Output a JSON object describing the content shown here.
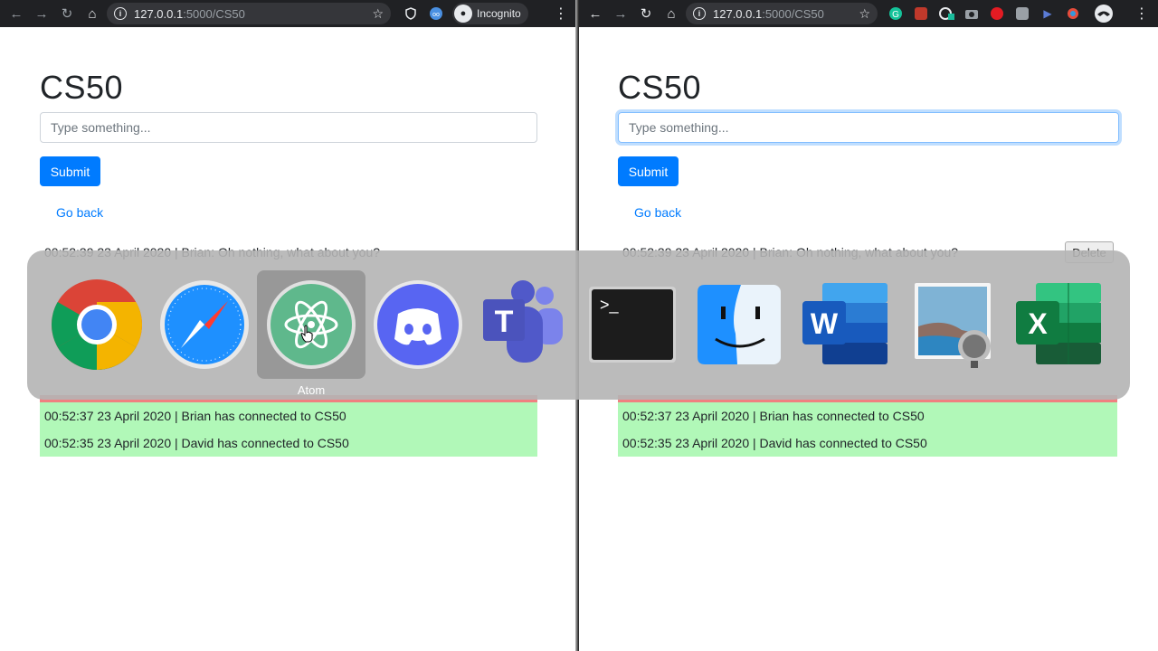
{
  "left_browser": {
    "url_host": "127.0.0.1",
    "url_path": ":5000/CS50",
    "incognito_label": "Incognito"
  },
  "right_browser": {
    "url_host": "127.0.0.1",
    "url_path": ":5000/CS50"
  },
  "left_page": {
    "title": "CS50",
    "input_placeholder": "Type something...",
    "submit_label": "Submit",
    "go_back_label": "Go back",
    "chat_message": "00:52:39 23 April 2020 | Brian: Oh nothing, what about you?",
    "connections": [
      "00:52:37 23 April 2020 | Brian has connected to CS50",
      "00:52:35 23 April 2020 | David has connected to CS50"
    ]
  },
  "right_page": {
    "title": "CS50",
    "input_placeholder": "Type something...",
    "submit_label": "Submit",
    "go_back_label": "Go back",
    "chat_message": "00:52:39 23 April 2020 | Brian: Oh nothing, what about you?",
    "delete_label": "Delete",
    "connections": [
      "00:52:37 23 April 2020 | Brian has connected to CS50",
      "00:52:35 23 April 2020 | David has connected to CS50"
    ]
  },
  "app_switcher": {
    "selected_label": "Atom",
    "apps": [
      "chrome-icon",
      "safari-icon",
      "atom-icon",
      "discord-icon",
      "teams-icon",
      "terminal-icon",
      "finder-icon",
      "word-icon",
      "preview-icon",
      "excel-icon"
    ]
  },
  "colors": {
    "primary": "#007bff",
    "connected_bg": "#b1f8b8",
    "deleted_bg": "#f08080",
    "chrome_toolbar": "#202124"
  }
}
